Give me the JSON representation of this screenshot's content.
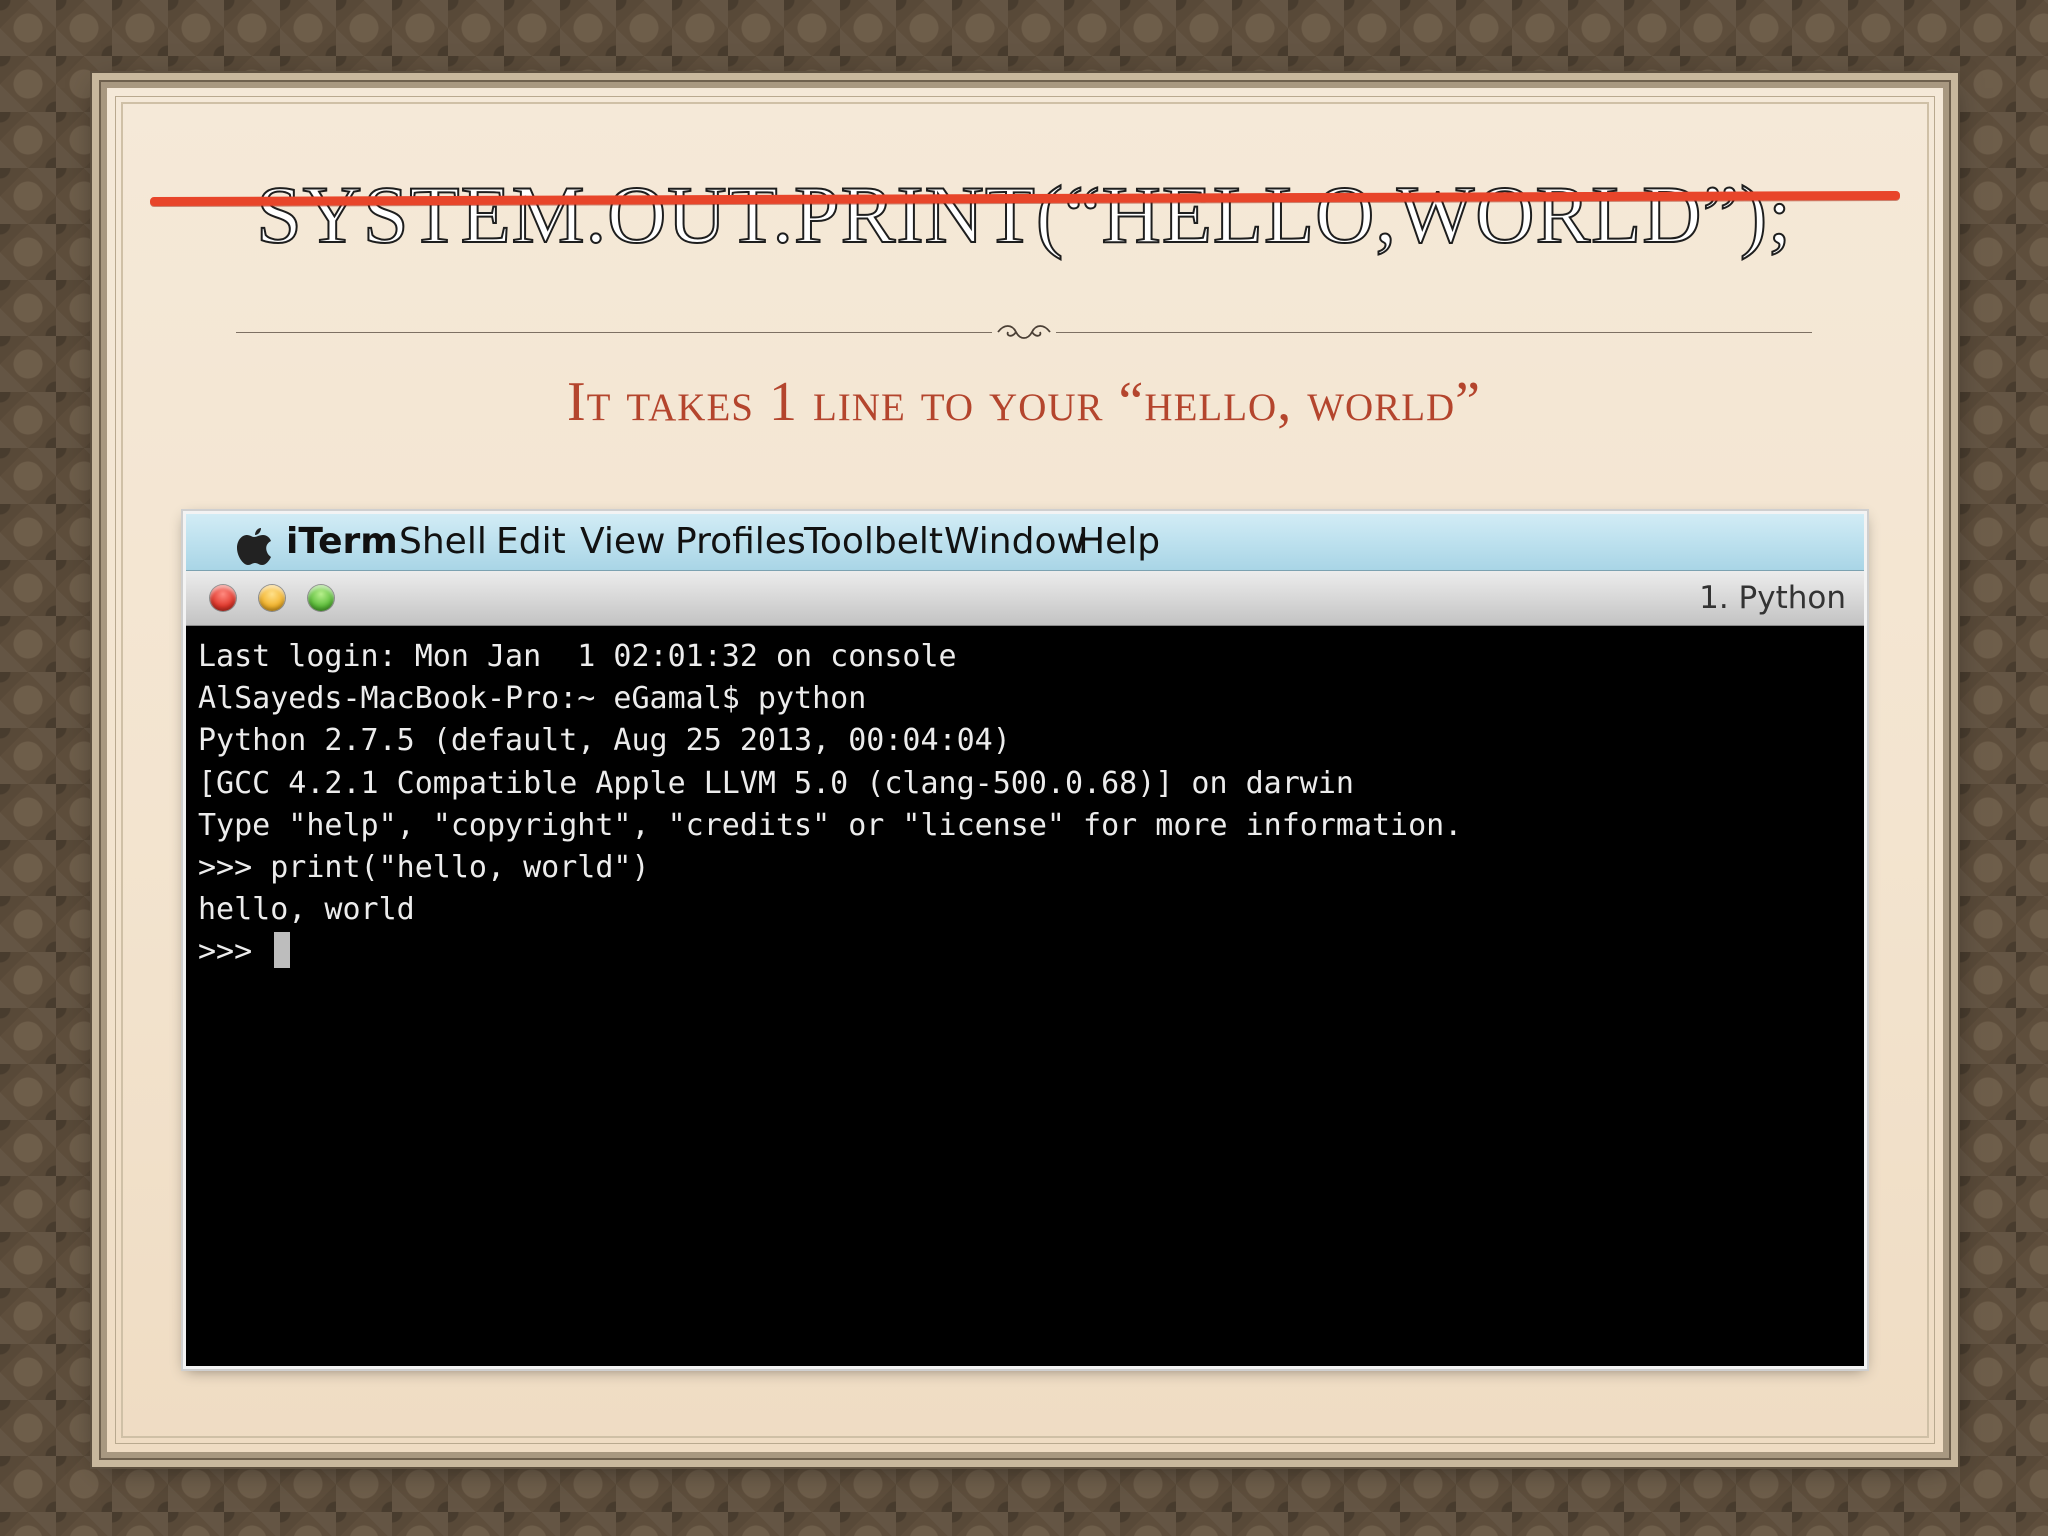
{
  "slide": {
    "title": "SYSTEM.OUT.PRINT(“HELLO,WORLD”);",
    "subtitle": "It takes 1 line to your “hello, world”",
    "strike_color": "#e8452a",
    "subtitle_color": "#b4452d"
  },
  "screenshot": {
    "menubar": {
      "apple_icon": "apple-icon",
      "items": [
        "iTerm",
        "Shell",
        "Edit",
        "View",
        "Profiles",
        "Toolbelt",
        "Window",
        "Help"
      ]
    },
    "window": {
      "tab_title": "1. Python",
      "traffic_lights": [
        "close",
        "minimize",
        "zoom"
      ]
    },
    "terminal": {
      "lines": [
        "Last login: Mon Jan  1 02:01:32 on console",
        "AlSayeds-MacBook-Pro:~ eGamal$ python",
        "Python 2.7.5 (default, Aug 25 2013, 00:04:04)",
        "[GCC 4.2.1 Compatible Apple LLVM 5.0 (clang-500.0.68)] on darwin",
        "Type \"help\", \"copyright\", \"credits\" or \"license\" for more information.",
        ">>> print(\"hello, world\")",
        "hello, world"
      ],
      "prompt": ">>> "
    }
  }
}
